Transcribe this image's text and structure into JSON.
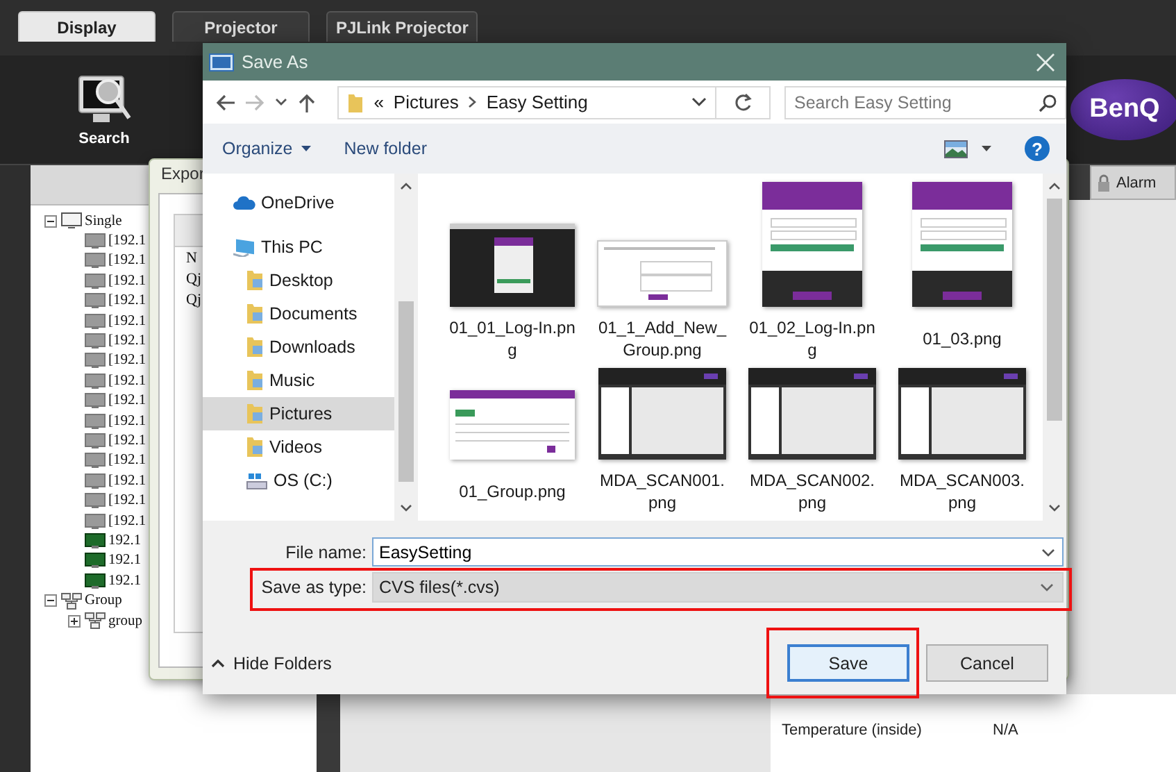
{
  "app": {
    "tabs": [
      {
        "label": "Display",
        "selected": true
      },
      {
        "label": "Projector",
        "selected": false
      },
      {
        "label": "PJLink Projector",
        "selected": false
      }
    ],
    "toolbar": [
      {
        "label": "Search"
      }
    ],
    "logo": "BenQ",
    "tree": [
      {
        "label": "Single",
        "kind": "single",
        "expanded": true,
        "children": [
          {
            "label": "[192.1",
            "kind": "device",
            "online": false
          },
          {
            "label": "[192.1",
            "kind": "device",
            "online": false
          },
          {
            "label": "[192.1",
            "kind": "device",
            "online": false
          },
          {
            "label": "[192.1",
            "kind": "device",
            "online": false
          },
          {
            "label": "[192.1",
            "kind": "device",
            "online": false
          },
          {
            "label": "[192.1",
            "kind": "device",
            "online": false
          },
          {
            "label": "[192.1",
            "kind": "device",
            "online": false
          },
          {
            "label": "[192.1",
            "kind": "device",
            "online": false
          },
          {
            "label": "[192.1",
            "kind": "device",
            "online": false
          },
          {
            "label": "[192.1",
            "kind": "device",
            "online": false
          },
          {
            "label": "[192.1",
            "kind": "device",
            "online": false
          },
          {
            "label": "[192.1",
            "kind": "device",
            "online": false
          },
          {
            "label": "[192.1",
            "kind": "device",
            "online": false
          },
          {
            "label": "[192.1",
            "kind": "device",
            "online": false
          },
          {
            "label": "[192.1",
            "kind": "device",
            "online": false
          },
          {
            "label": "192.1",
            "kind": "device",
            "online": true
          },
          {
            "label": "192.1",
            "kind": "device",
            "online": true
          },
          {
            "label": "192.1",
            "kind": "device",
            "online": true
          }
        ]
      },
      {
        "label": "Group",
        "kind": "group",
        "expanded": true,
        "children": [
          {
            "label": "group",
            "kind": "group",
            "expanded": false
          }
        ]
      }
    ],
    "side_tab": "Alarm",
    "status_rows": [
      {
        "label": "Temperature (inside)",
        "value": "N/A"
      }
    ]
  },
  "export_window": {
    "title": "Expor",
    "cells": [
      "N",
      "Qj",
      "Qj"
    ]
  },
  "save_dialog": {
    "title": "Save As",
    "path_prefix": "«",
    "path": [
      "Pictures",
      "Easy Setting"
    ],
    "search": {
      "placeholder": "Search Easy Setting"
    },
    "commands": [
      "Organize",
      "New folder"
    ],
    "help": "?",
    "nav": [
      {
        "label": "OneDrive",
        "kind": "cloud",
        "selected": false
      },
      {
        "label": "This PC",
        "kind": "pc",
        "selected": false,
        "children": [
          {
            "label": "Desktop",
            "kind": "folder",
            "selected": false
          },
          {
            "label": "Documents",
            "kind": "folder",
            "selected": false
          },
          {
            "label": "Downloads",
            "kind": "folder",
            "selected": false
          },
          {
            "label": "Music",
            "kind": "folder",
            "selected": false
          },
          {
            "label": "Pictures",
            "kind": "folder",
            "selected": true
          },
          {
            "label": "Videos",
            "kind": "folder",
            "selected": false
          },
          {
            "label": "OS (C:)",
            "kind": "drive",
            "selected": false
          }
        ]
      }
    ],
    "files": [
      {
        "name": "01_01_Log-In.png",
        "kind": "dark"
      },
      {
        "name": "01_1_Add_New_Group.png",
        "kind": "form"
      },
      {
        "name": "01_02_Log-In.png",
        "kind": "login"
      },
      {
        "name": "01_03.png",
        "kind": "login"
      },
      {
        "name": "01_Group.png",
        "kind": "table"
      },
      {
        "name": "MDA_SCAN001.png",
        "kind": "app"
      },
      {
        "name": "MDA_SCAN002.png",
        "kind": "app"
      },
      {
        "name": "MDA_SCAN003.png",
        "kind": "app"
      }
    ],
    "file_name": {
      "label": "File name:",
      "value": "EasySetting"
    },
    "save_type": {
      "label": "Save as type:",
      "value": "CVS files(*.cvs)",
      "highlighted": true
    },
    "hide_folders": "Hide Folders",
    "buttons": [
      {
        "label": "Save",
        "default": true,
        "highlighted": true
      },
      {
        "label": "Cancel",
        "default": false,
        "highlighted": false
      }
    ]
  }
}
